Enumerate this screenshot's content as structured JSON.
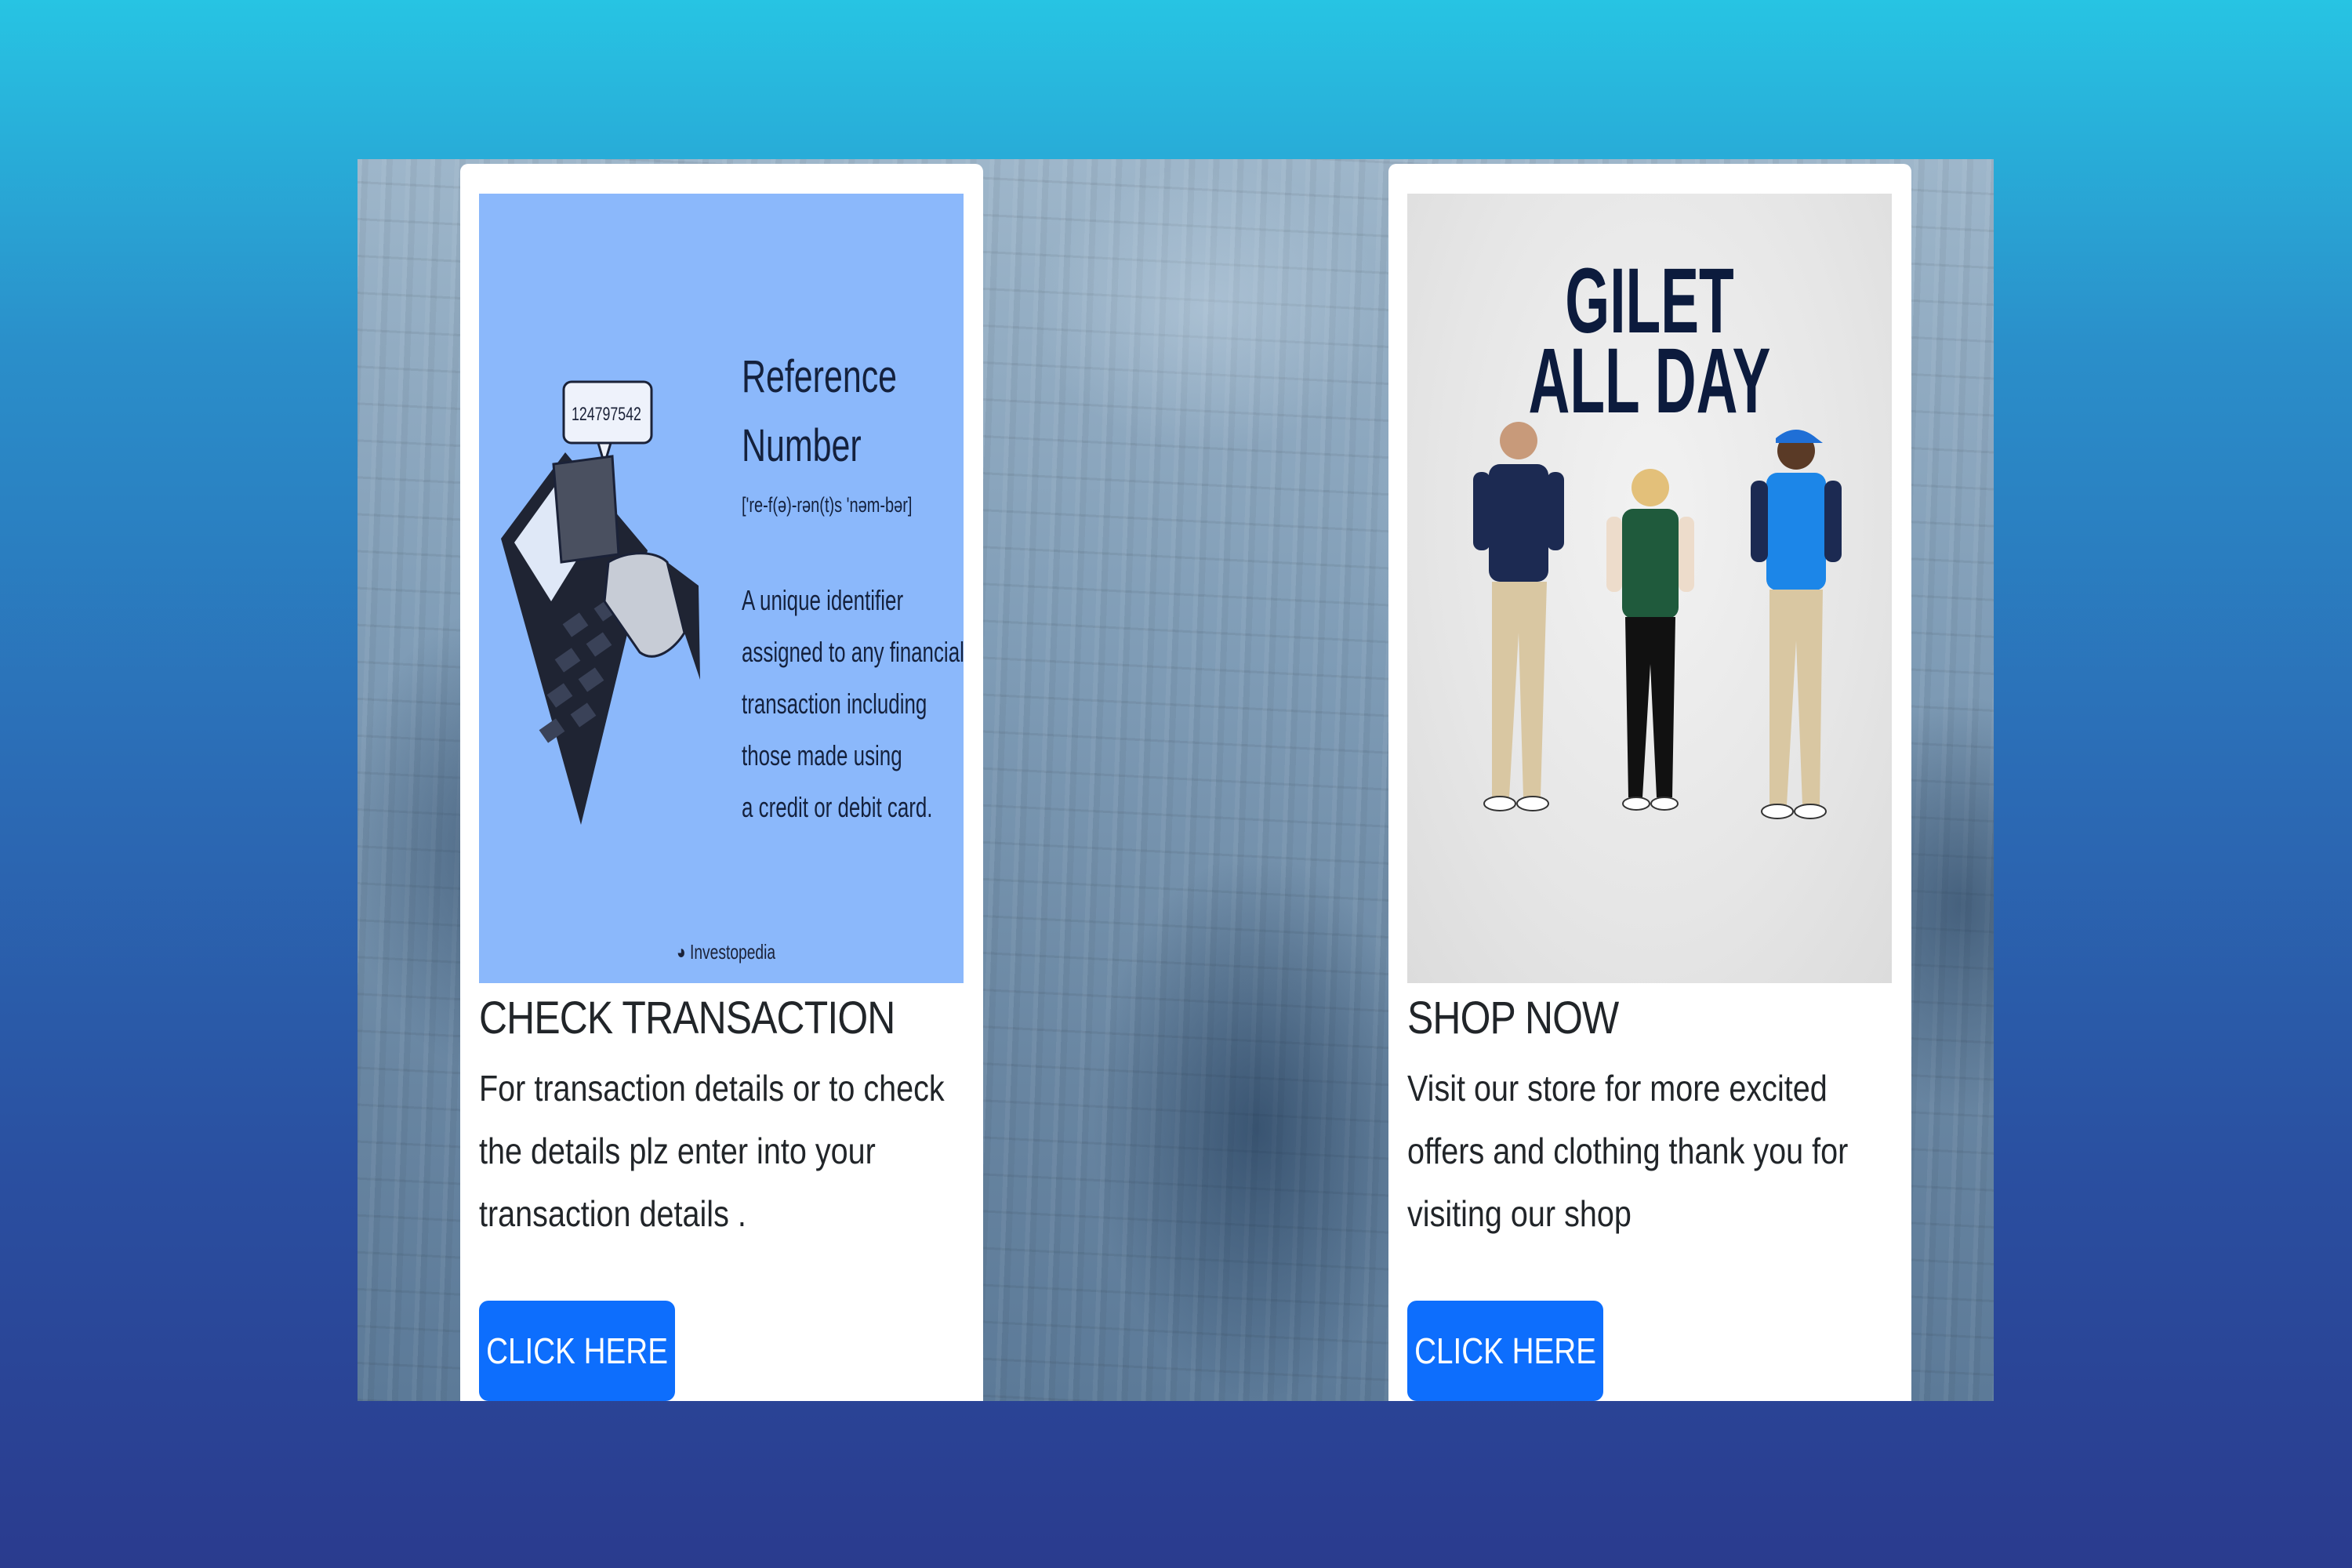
{
  "cards": [
    {
      "title": "CHECK TRANSACTION",
      "text": "For transaction details or to check the details plz enter into your transaction details .",
      "button_label": "CLICK HERE",
      "image": {
        "heading_line1": "Reference",
        "heading_line2": "Number",
        "phonetic": "['re-f(ə)-rən(t)s 'nəm-bər]",
        "description_lines": [
          "A unique identifier",
          "assigned to any financial",
          "transaction including",
          "those made using",
          "a credit or debit card."
        ],
        "bubble_number": "124797542",
        "logo_text": "Investopedia"
      }
    },
    {
      "title": "SHOP NOW",
      "text": "Visit our store for more excited offers and clothing thank you for visiting our shop",
      "button_label": "CLICK HERE",
      "image": {
        "headline_line1": "GILET",
        "headline_line2": "ALL DAY"
      }
    }
  ],
  "colors": {
    "button": "#0d6efd",
    "reference_image_bg": "#8bb8fb",
    "gilet_headline": "#0c1b3d",
    "page_gradient_top": "#27c4e3",
    "page_gradient_bottom": "#2a3b8e"
  }
}
